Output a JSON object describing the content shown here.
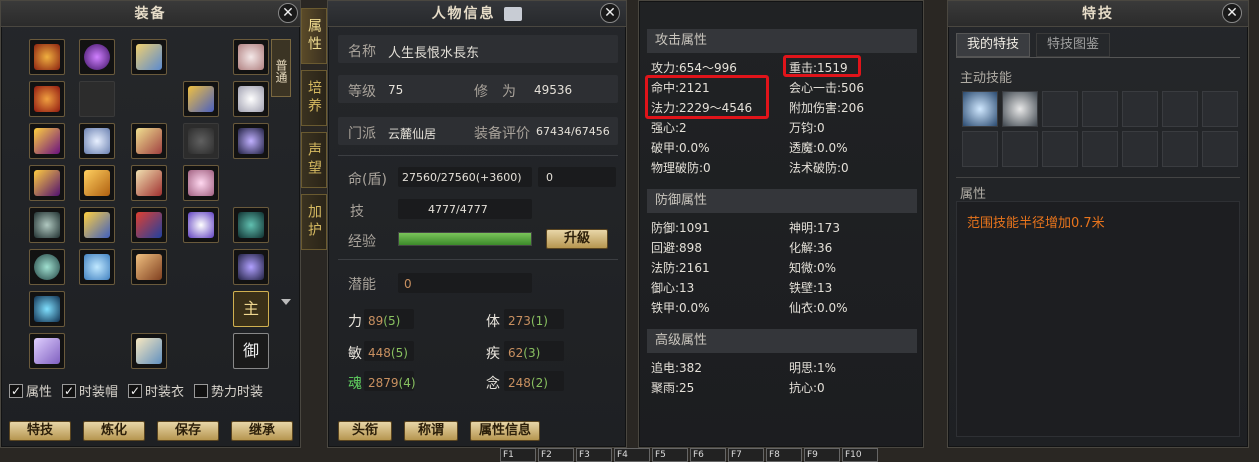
{
  "equipment": {
    "title": "装备",
    "side_tag_normal": "普通",
    "side_btn_main": "主",
    "side_btn_guard": "御",
    "checkboxes": [
      {
        "label": "属性",
        "checked": true
      },
      {
        "label": "时装帽",
        "checked": true
      },
      {
        "label": "时装衣",
        "checked": true
      },
      {
        "label": "势力时装",
        "checked": false
      }
    ],
    "buttons": [
      "特技",
      "炼化",
      "保存",
      "继承"
    ]
  },
  "tabs": [
    "属性",
    "培养",
    "声望",
    "加护"
  ],
  "character": {
    "title": "人物信息",
    "name_label": "名称",
    "name_value": "人生長恨水長东",
    "level_label": "等级",
    "level_value": "75",
    "cultivation_label": "修　为",
    "cultivation_value": "49536",
    "sect_label": "门派",
    "sect_value": "云麓仙居",
    "rating_label": "装备评价",
    "rating_value": "67434/67456",
    "hp_label": "命(盾)",
    "hp_value": "27560/27560(+3600)",
    "shield_value": "0",
    "skill_label": "技",
    "skill_value": "4777/4777",
    "exp_label": "经验",
    "exp_fraction": 1.0,
    "levelup_label": "升級",
    "potential_label": "潜能",
    "potential_value": "0",
    "stats": [
      {
        "name": "力",
        "value": "89",
        "sub": "(5)"
      },
      {
        "name": "体",
        "value": "273",
        "sub": "(1)"
      },
      {
        "name": "敏",
        "value": "448",
        "sub": "(5)"
      },
      {
        "name": "疾",
        "value": "62",
        "sub": "(3)"
      },
      {
        "name": "魂",
        "value": "2879",
        "sub": "(4)"
      },
      {
        "name": "念",
        "value": "248",
        "sub": "(2)"
      }
    ],
    "buttons": [
      "头衔",
      "称谓",
      "属性信息"
    ]
  },
  "attributes": {
    "attack_header": "攻击属性",
    "attack": [
      "攻力:654～996",
      "重击:1519",
      "命中:2121",
      "会心一击:506",
      "法力:2229～4546",
      "附加伤害:206",
      "强心:2",
      "万钧:0",
      "破甲:0.0%",
      "透魔:0.0%",
      "物理破防:0",
      "法术破防:0"
    ],
    "defense_header": "防御属性",
    "defense": [
      "防御:1091",
      "神明:173",
      "回避:898",
      "化解:36",
      "法防:2161",
      "知微:0%",
      "御心:13",
      "铁壁:13",
      "铁甲:0.0%",
      "仙衣:0.0%"
    ],
    "advanced_header": "高级属性",
    "advanced": [
      "追电:382",
      "明思:1%",
      "聚雨:25",
      "抗心:0"
    ]
  },
  "skills": {
    "title": "特技",
    "tab_mine": "我的特技",
    "tab_guide": "特技图鉴",
    "active_label": "主动技能",
    "attr_label": "属性",
    "desc": "范围技能半径增加0.7米"
  },
  "hotkeys": [
    "F1",
    "F2",
    "F3",
    "F4",
    "F5",
    "F6",
    "F7",
    "F8",
    "F9",
    "F10"
  ]
}
